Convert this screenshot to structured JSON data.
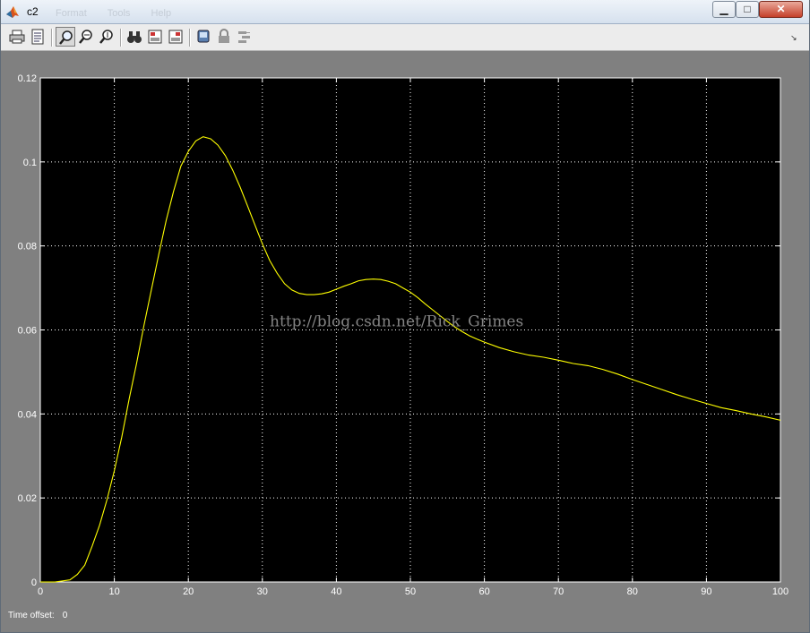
{
  "window": {
    "title": "c2",
    "menu_faded": [
      "Format",
      "Tools",
      "Help"
    ],
    "controls": {
      "minimize": "▁",
      "maximize": "□",
      "close": "✕"
    }
  },
  "toolbar": {
    "icons": [
      "print-icon",
      "parameters-icon",
      "zoom-icon",
      "zoom-x-icon",
      "zoom-y-icon",
      "autoscale-icon",
      "save-axes-icon",
      "restore-axes-icon",
      "floating-scope-icon",
      "lock-axes-icon",
      "signal-selection-icon"
    ],
    "active": "zoom-icon",
    "overflow": "↘"
  },
  "footer": {
    "time_offset_label": "Time offset:",
    "time_offset_value": "0"
  },
  "watermark": "http://blog.csdn.net/Rick_Grimes",
  "colors": {
    "plot_bg": "#000000",
    "trace": "#ffff00",
    "grid": "#ffffff",
    "window_bg": "#808080"
  },
  "chart_data": {
    "type": "line",
    "title": "",
    "xlabel": "",
    "ylabel": "",
    "xlim": [
      0,
      100
    ],
    "ylim": [
      0,
      0.12
    ],
    "xticks": [
      0,
      10,
      20,
      30,
      40,
      50,
      60,
      70,
      80,
      90,
      100
    ],
    "yticks": [
      0,
      0.02,
      0.04,
      0.06,
      0.08,
      0.1,
      0.12
    ],
    "ytick_labels": [
      "0",
      "0.02",
      "0.04",
      "0.06",
      "0.08",
      "0.1",
      "0.12"
    ],
    "grid": true,
    "series": [
      {
        "x": [
          0,
          2,
          4,
          5,
          6,
          7,
          8,
          9,
          10,
          11,
          12,
          13,
          14,
          15,
          16,
          17,
          18,
          19,
          20,
          21,
          22,
          23,
          24,
          25,
          26,
          27,
          28,
          29,
          30,
          31,
          32,
          33,
          34,
          35,
          36,
          37,
          38,
          39,
          40,
          41,
          42,
          43,
          44,
          45,
          46,
          47,
          48,
          49,
          50,
          51,
          52,
          53,
          54,
          55,
          56,
          57,
          58,
          59,
          60,
          62,
          64,
          66,
          68,
          70,
          72,
          74,
          76,
          78,
          80,
          82,
          84,
          86,
          88,
          90,
          92,
          94,
          96,
          98,
          100
        ],
        "y": [
          0,
          0,
          0.0005,
          0.0018,
          0.004,
          0.0085,
          0.0135,
          0.0195,
          0.0265,
          0.0345,
          0.0435,
          0.052,
          0.061,
          0.0695,
          0.078,
          0.086,
          0.093,
          0.099,
          0.1025,
          0.105,
          0.106,
          0.1055,
          0.104,
          0.1015,
          0.098,
          0.094,
          0.0895,
          0.085,
          0.0805,
          0.0765,
          0.0735,
          0.071,
          0.0695,
          0.0687,
          0.0684,
          0.0684,
          0.0686,
          0.069,
          0.0697,
          0.0704,
          0.071,
          0.0717,
          0.072,
          0.0721,
          0.072,
          0.0716,
          0.071,
          0.07,
          0.069,
          0.0677,
          0.0662,
          0.0648,
          0.0634,
          0.062,
          0.0607,
          0.0596,
          0.0586,
          0.0578,
          0.0571,
          0.0558,
          0.0548,
          0.054,
          0.0535,
          0.0528,
          0.052,
          0.0515,
          0.0506,
          0.0495,
          0.0482,
          0.047,
          0.0458,
          0.0446,
          0.0435,
          0.0425,
          0.0415,
          0.0408,
          0.04,
          0.0393,
          0.0385
        ]
      }
    ]
  }
}
